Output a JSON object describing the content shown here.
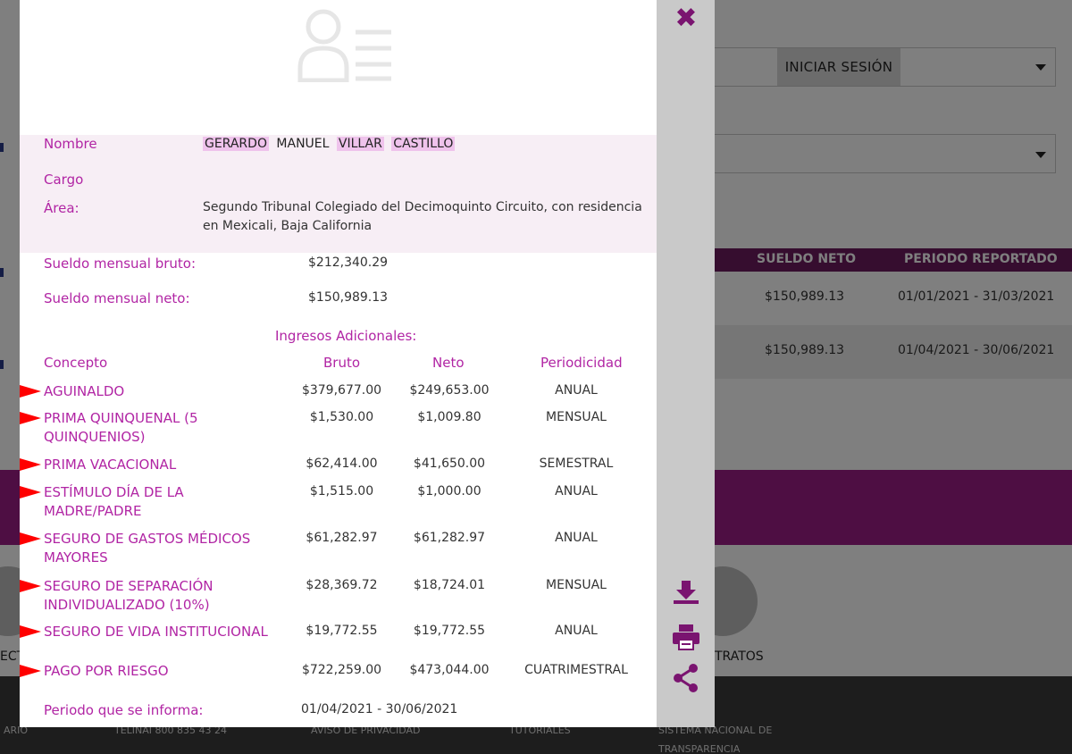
{
  "background": {
    "login_button": "INICIAR SESIÓN",
    "table_headers": [
      "SUELDO NETO",
      "PERIODO REPORTADO"
    ],
    "table_rows": [
      {
        "neto": "$150,989.13",
        "periodo": "01/01/2021 - 31/03/2021"
      },
      {
        "neto": "$150,989.13",
        "periodo": "01/04/2021 - 30/06/2021"
      }
    ],
    "bottom_labels": {
      "left": "ECT",
      "right": "TRATOS"
    },
    "footer": {
      "item_1": "ARIO",
      "item_2": "TELINAI 800 835 43 24",
      "item_3": "AVISO DE PRIVACIDAD",
      "item_4": "TUTORIALES",
      "item_5_line1": "SISTEMA NACIONAL DE",
      "item_5_line2": "TRANSPARENCIA"
    }
  },
  "modal": {
    "close_symbol": "✖",
    "labels": {
      "nombre": "Nombre",
      "cargo": "Cargo",
      "area": "Área:",
      "bruto": "Sueldo mensual bruto:",
      "neto": "Sueldo mensual neto:"
    },
    "name_parts": [
      "GERARDO",
      "MANUEL",
      "VILLAR",
      "CASTILLO"
    ],
    "area_value": "Segundo Tribunal Colegiado del Decimoquinto Circuito, con residencia en Mexicali, Baja California",
    "sueldo_bruto": "$212,340.29",
    "sueldo_neto": "$150,989.13",
    "ingresos_title": "Ingresos Adicionales:",
    "headers": {
      "concepto": "Concepto",
      "bruto": "Bruto",
      "neto": "Neto",
      "periodicidad": "Periodicidad"
    },
    "rows": [
      {
        "concepto": "AGUINALDO",
        "bruto": "$379,677.00",
        "neto": "$249,653.00",
        "periodicidad": "ANUAL"
      },
      {
        "concepto": "PRIMA QUINQUENAL (5 QUINQUENIOS)",
        "bruto": "$1,530.00",
        "neto": "$1,009.80",
        "periodicidad": "MENSUAL"
      },
      {
        "concepto": "PRIMA VACACIONAL",
        "bruto": "$62,414.00",
        "neto": "$41,650.00",
        "periodicidad": "SEMESTRAL"
      },
      {
        "concepto": "ESTÍMULO DÍA DE LA MADRE/PADRE",
        "bruto": "$1,515.00",
        "neto": "$1,000.00",
        "periodicidad": "ANUAL"
      },
      {
        "concepto": "SEGURO DE GASTOS MÉDICOS MAYORES",
        "bruto": "$61,282.97",
        "neto": "$61,282.97",
        "periodicidad": "ANUAL"
      },
      {
        "concepto": "SEGURO DE SEPARACIÓN INDIVIDUALIZADO (10%)",
        "bruto": "$28,369.72",
        "neto": "$18,724.01",
        "periodicidad": "MENSUAL"
      },
      {
        "concepto": "SEGURO DE VIDA INSTITUCIONAL",
        "bruto": "$19,772.55",
        "neto": "$19,772.55",
        "periodicidad": "ANUAL"
      },
      {
        "concepto": "PAGO POR RIESGO",
        "bruto": "$722,259.00",
        "neto": "$473,044.00",
        "periodicidad": "CUATRIMESTRAL"
      }
    ],
    "periodo_label": "Periodo que se informa:",
    "periodo_value": "01/04/2021 - 30/06/2021",
    "colors": {
      "accent": "#b125a4",
      "brand": "#7a1470",
      "highlight": "#efc3ec"
    }
  }
}
